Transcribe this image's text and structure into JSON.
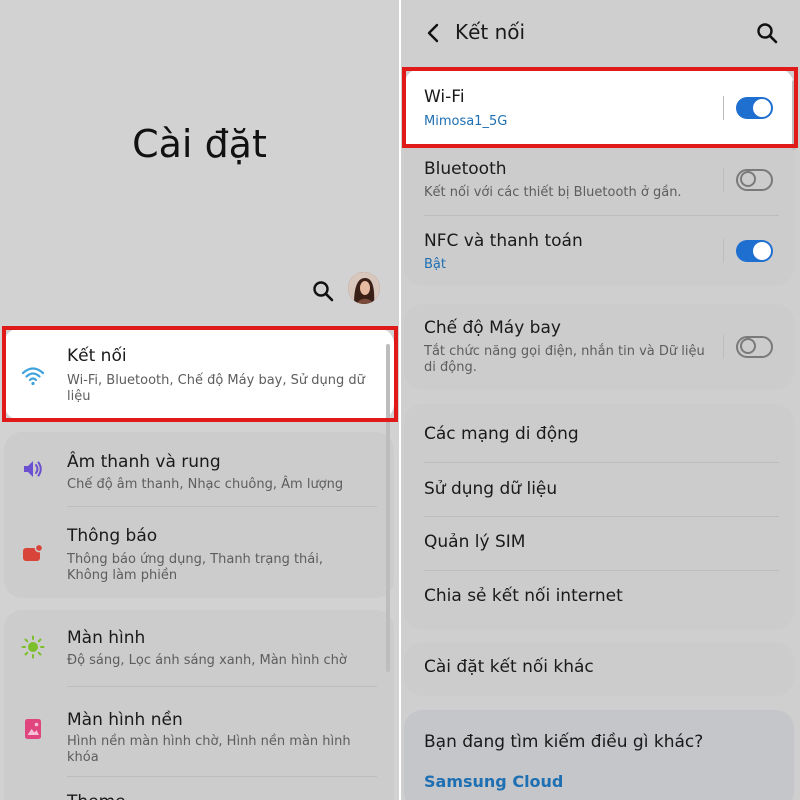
{
  "left": {
    "title": "Cài đặt",
    "items": [
      {
        "title": "Kết nối",
        "subtitle": "Wi-Fi, Bluetooth, Chế độ Máy bay, Sử dụng dữ liệu",
        "icon": "wifi-icon"
      },
      {
        "title": "Âm thanh và rung",
        "subtitle": "Chế độ âm thanh, Nhạc chuông, Âm lượng",
        "icon": "sound-icon"
      },
      {
        "title": "Thông báo",
        "subtitle": "Thông báo ứng dụng, Thanh trạng thái, Không làm phiền",
        "icon": "notification-icon"
      },
      {
        "title": "Màn hình",
        "subtitle": "Độ sáng, Lọc ánh sáng xanh, Màn hình chờ",
        "icon": "display-icon"
      },
      {
        "title": "Màn hình nền",
        "subtitle": "Hình nền màn hình chờ, Hình nền màn hình khóa",
        "icon": "wallpaper-icon"
      },
      {
        "title": "Theme",
        "subtitle": "",
        "icon": "theme-icon"
      }
    ]
  },
  "right": {
    "header_title": "Kết nối",
    "items": [
      {
        "title": "Wi-Fi",
        "subtitle": "Mimosa1_5G",
        "toggle": "on"
      },
      {
        "title": "Bluetooth",
        "subtitle": "Kết nối với các thiết bị Bluetooth ở gần.",
        "toggle": "off"
      },
      {
        "title": "NFC và thanh toán",
        "subtitle": "Bật",
        "toggle": "on"
      },
      {
        "title": "Chế độ Máy bay",
        "subtitle": "Tắt chức năng gọi điện, nhắn tin và Dữ liệu di động.",
        "toggle": "off"
      },
      {
        "title": "Các mạng di động"
      },
      {
        "title": "Sử dụng dữ liệu"
      },
      {
        "title": "Quản lý SIM"
      },
      {
        "title": "Chia sẻ kết nối internet"
      },
      {
        "title": "Cài đặt kết nối khác"
      }
    ],
    "suggestion_title": "Bạn đang tìm kiếm điều gì khác?",
    "suggestion_link": "Samsung Cloud"
  },
  "colors": {
    "highlight": "#e01919",
    "toggle_on": "#1f6fd0",
    "link_blue": "#1f6fb3",
    "background": "#d2d2d2"
  }
}
